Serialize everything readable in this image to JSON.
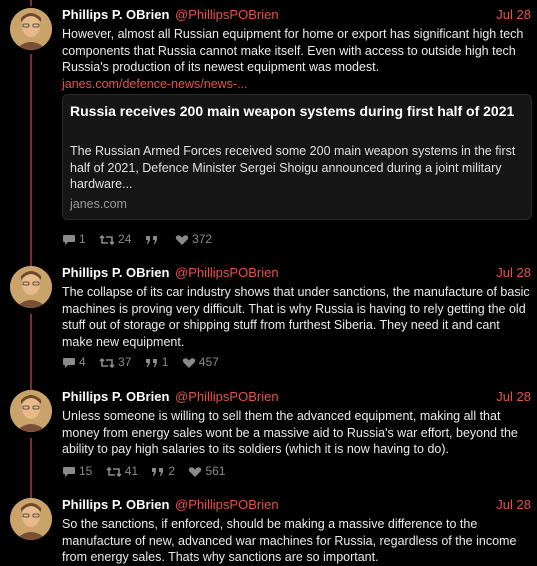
{
  "colors": {
    "background": "#000000",
    "accent": "#e5534b",
    "thread_line": "#7a2f33",
    "text": "#ececec",
    "muted": "#8a8a8a"
  },
  "tweets": [
    {
      "author_name": "Phillips P. OBrien",
      "author_handle": "@PhillipsPOBrien",
      "date": "Jul 28",
      "text": "However, almost all Russian equipment for home or export has significant high tech components that Russia cannot make itself. Even with access to outside high tech Russia's production of its newest equipment was modest.",
      "link_text": "janes.com/defence-news/news-...",
      "card": {
        "title": "Russia receives 200 main weapon systems during first half of 2021",
        "description": "The Russian Armed Forces received some 200 main weapon systems in the first half of 2021, Defence Minister Sergei Shoigu announced during a joint military hardware...",
        "domain": "janes.com"
      },
      "replies": "1",
      "retweets": "24",
      "quotes": "",
      "likes": "372"
    },
    {
      "author_name": "Phillips P. OBrien",
      "author_handle": "@PhillipsPOBrien",
      "date": "Jul 28",
      "text": "The collapse of its car industry shows that under sanctions, the manufacture of basic machines is proving very difficult. That is why Russia is having to rely getting the old stuff out of storage or shipping stuff from furthest Siberia. They need it and cant make new equipment.",
      "replies": "4",
      "retweets": "37",
      "quotes": "1",
      "likes": "457"
    },
    {
      "author_name": "Phillips P. OBrien",
      "author_handle": "@PhillipsPOBrien",
      "date": "Jul 28",
      "text": "Unless someone is willing to sell them the advanced equipment, making all that money from energy sales wont be a massive aid to Russia's war effort, beyond the ability to pay high salaries to its soldiers (which it is now having to do).",
      "replies": "15",
      "retweets": "41",
      "quotes": "2",
      "likes": "561"
    },
    {
      "author_name": "Phillips P. OBrien",
      "author_handle": "@PhillipsPOBrien",
      "date": "Jul 28",
      "text": "So the sanctions, if enforced, should be making a massive difference to the manufacture of new, advanced war machines for Russia, regardless of the income from energy sales. Thats why sanctions are so important."
    }
  ],
  "icons": {
    "reply": "comment-icon",
    "retweet": "retweet-icon",
    "quote": "quote-icon",
    "like": "heart-icon"
  }
}
